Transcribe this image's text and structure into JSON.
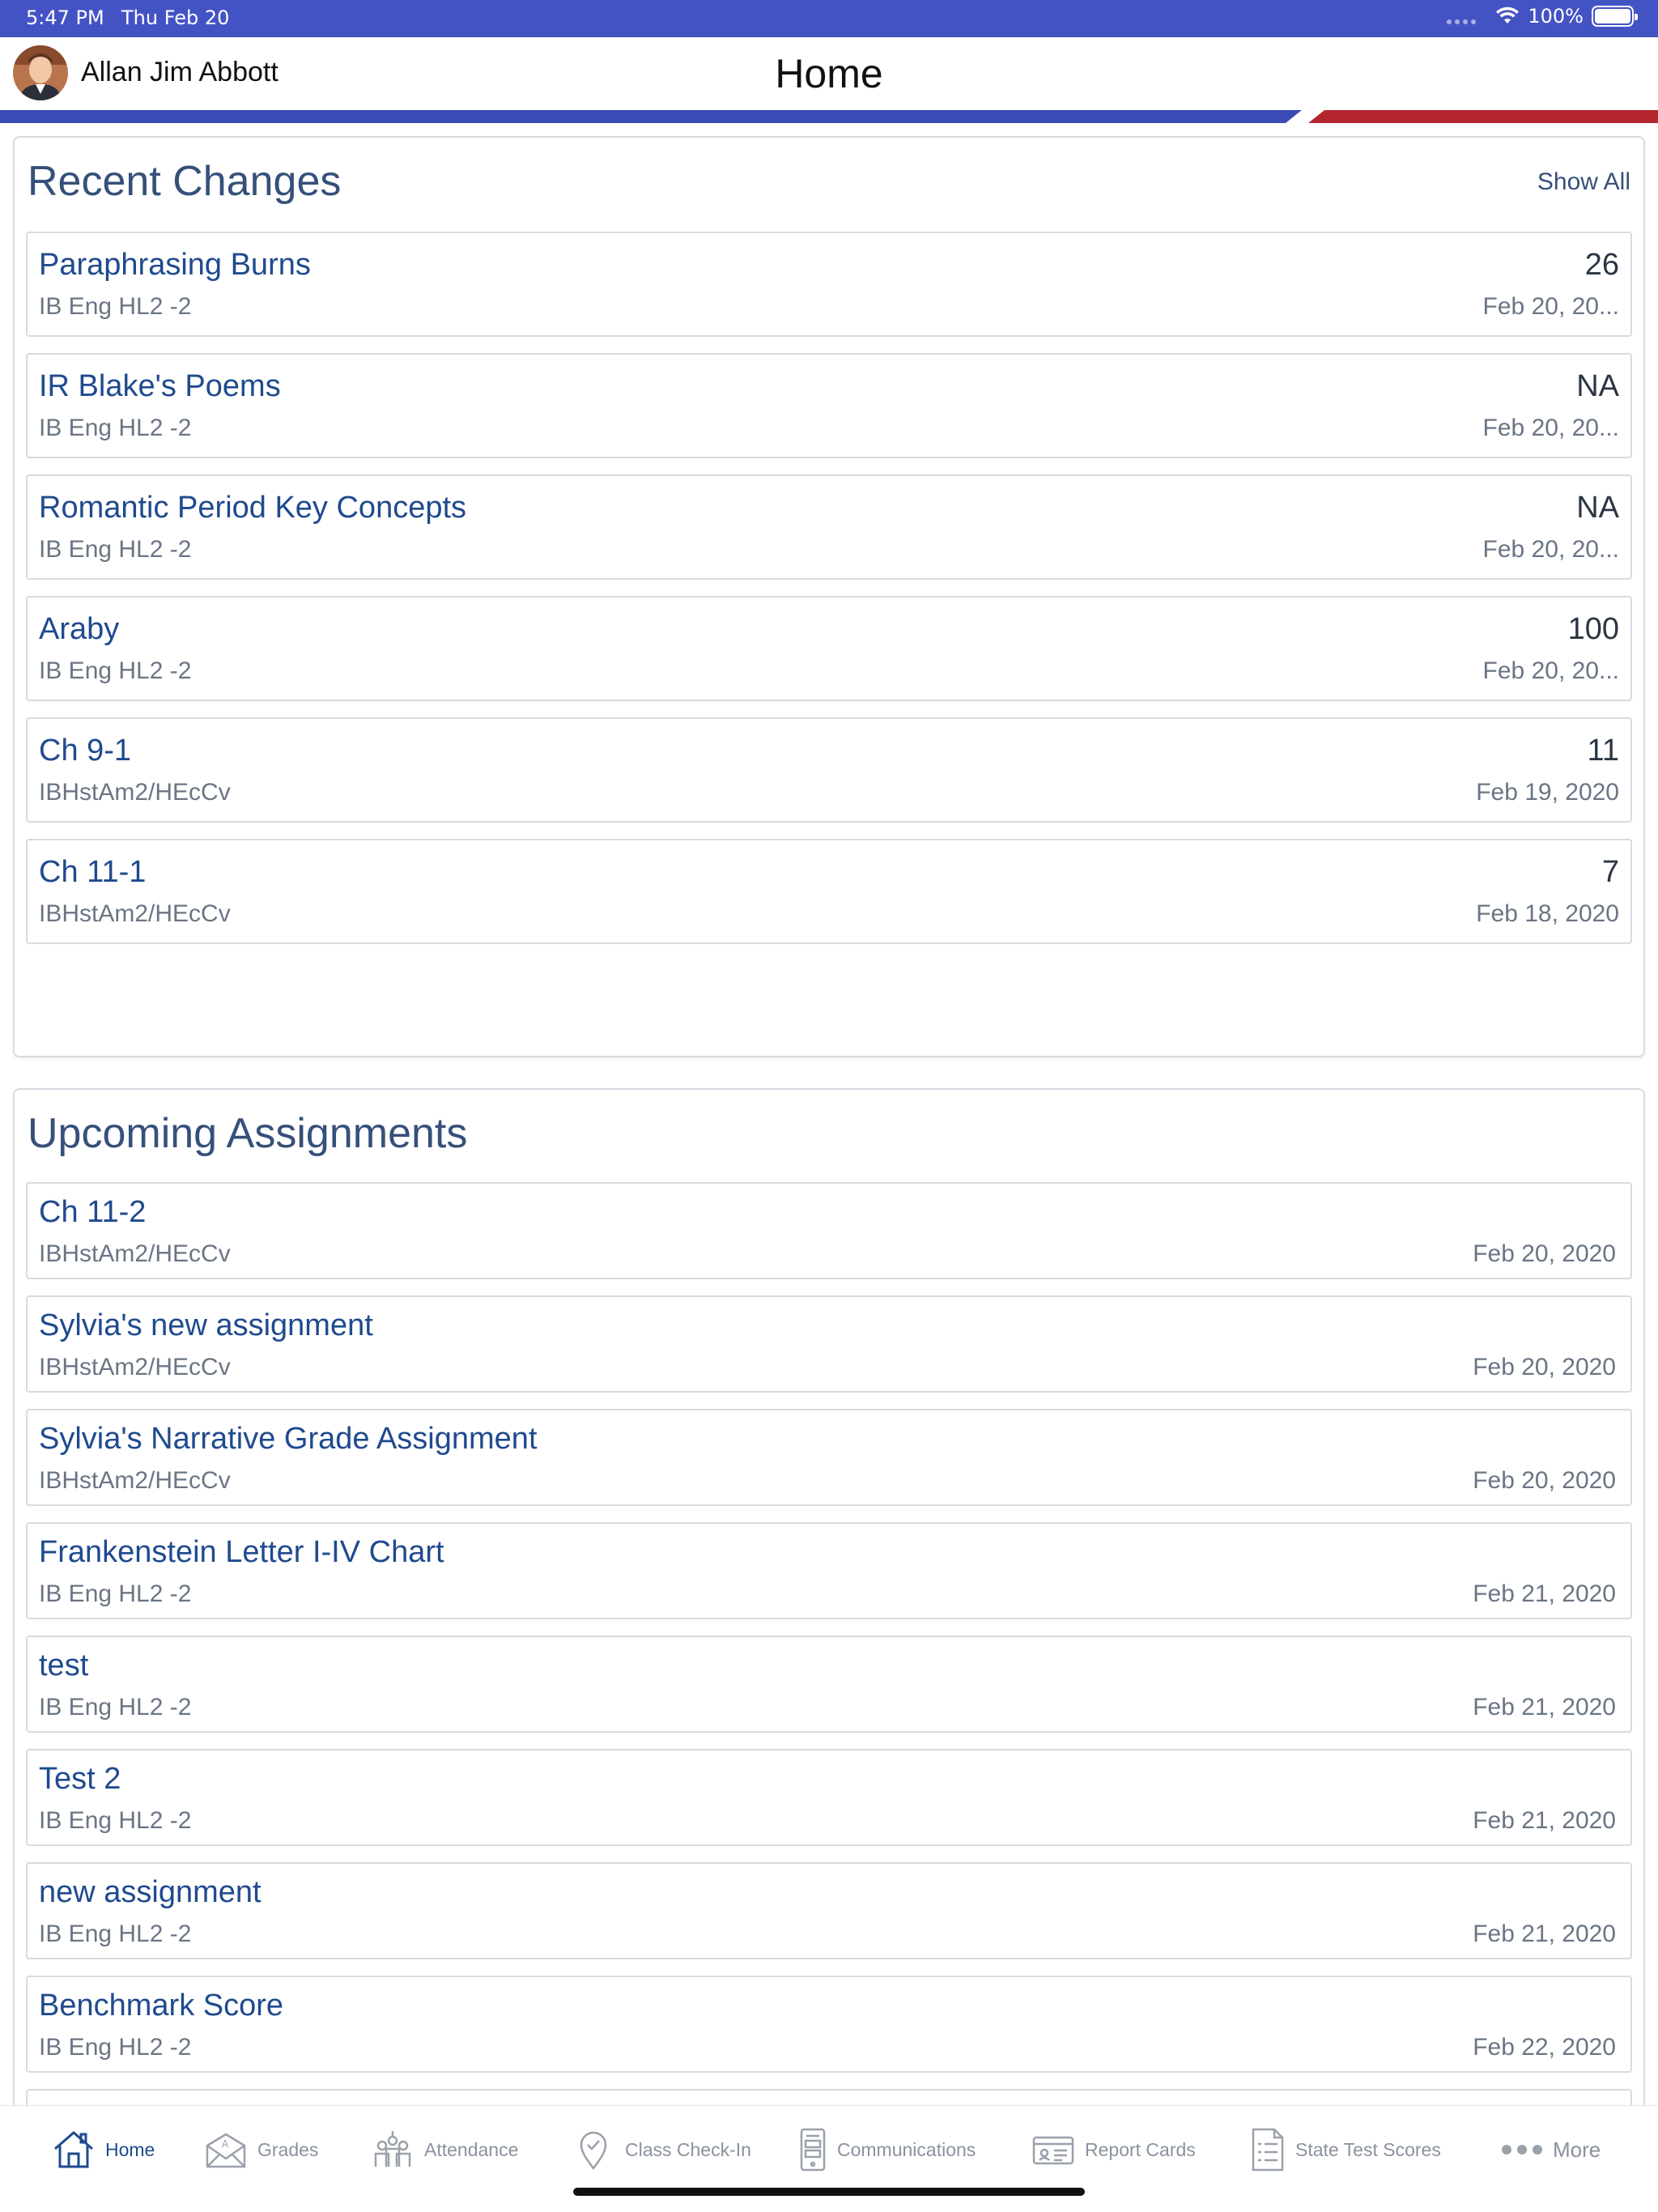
{
  "status_bar": {
    "time": "5:47 PM",
    "date": "Thu Feb 20",
    "battery": "100%"
  },
  "header": {
    "user_name": "Allan Jim Abbott",
    "title": "Home"
  },
  "recent_changes": {
    "title": "Recent Changes",
    "show_all": "Show All",
    "items": [
      {
        "title": "Paraphrasing Burns",
        "course": "IB Eng HL2 -2",
        "score": "26",
        "date": "Feb 20, 20..."
      },
      {
        "title": "IR Blake's Poems",
        "course": "IB Eng HL2 -2",
        "score": "NA",
        "date": "Feb 20, 20..."
      },
      {
        "title": "Romantic Period Key Concepts",
        "course": "IB Eng HL2 -2",
        "score": "NA",
        "date": "Feb 20, 20..."
      },
      {
        "title": "Araby",
        "course": "IB Eng HL2 -2",
        "score": "100",
        "date": "Feb 20, 20..."
      },
      {
        "title": "Ch 9-1",
        "course": "IBHstAm2/HEcCv",
        "score": "11",
        "date": "Feb 19, 2020"
      },
      {
        "title": "Ch 11-1",
        "course": "IBHstAm2/HEcCv",
        "score": "7",
        "date": "Feb 18, 2020"
      }
    ]
  },
  "upcoming_assignments": {
    "title": "Upcoming Assignments",
    "items": [
      {
        "title": "Ch 11-2",
        "course": "IBHstAm2/HEcCv",
        "date": "Feb 20, 2020"
      },
      {
        "title": "Sylvia's new assignment",
        "course": "IBHstAm2/HEcCv",
        "date": "Feb 20, 2020"
      },
      {
        "title": "Sylvia's Narrative Grade Assignment",
        "course": "IBHstAm2/HEcCv",
        "date": "Feb 20, 2020"
      },
      {
        "title": "Frankenstein Letter I-IV Chart",
        "course": "IB Eng HL2 -2",
        "date": "Feb 21, 2020"
      },
      {
        "title": "test",
        "course": "IB Eng HL2 -2",
        "date": "Feb 21, 2020"
      },
      {
        "title": "Test 2",
        "course": "IB Eng HL2 -2",
        "date": "Feb 21, 2020"
      },
      {
        "title": "new assignment",
        "course": "IB Eng HL2 -2",
        "date": "Feb 21, 2020"
      },
      {
        "title": "Benchmark Score",
        "course": "IB Eng HL2 -2",
        "date": "Feb 22, 2020"
      }
    ]
  },
  "tab_bar": {
    "tabs": [
      {
        "label": "Home",
        "icon": "home-icon"
      },
      {
        "label": "Grades",
        "icon": "grades-icon"
      },
      {
        "label": "Attendance",
        "icon": "attendance-icon"
      },
      {
        "label": "Class Check-In",
        "icon": "check-in-icon"
      },
      {
        "label": "Communications",
        "icon": "communications-icon"
      },
      {
        "label": "Report Cards",
        "icon": "report-cards-icon"
      },
      {
        "label": "State Test Scores",
        "icon": "state-test-scores-icon"
      },
      {
        "label": "More",
        "icon": "more-icon"
      }
    ]
  },
  "colors": {
    "status_bar": "#4453c4",
    "accent_blue": "#3a4bb5",
    "accent_red": "#b3262e",
    "link": "#1f4a8f"
  }
}
